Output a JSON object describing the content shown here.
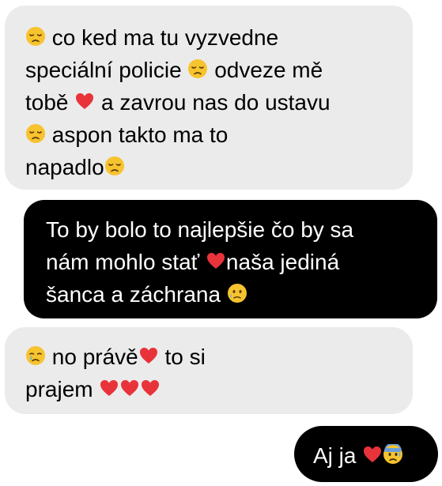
{
  "colors": {
    "received_bg": "#ebebeb",
    "received_text": "#000000",
    "sent_bg": "#000000",
    "sent_text": "#ffffff",
    "heart": "#e8333b",
    "emoji_yellow": "#f7c32e"
  },
  "messages": [
    {
      "direction": "received",
      "lines": [
        [
          {
            "icon": "disappointed-face"
          },
          {
            "text": " co ked ma tu vyzvedne"
          }
        ],
        [
          {
            "text": "speciální policie "
          },
          {
            "icon": "disappointed-face"
          },
          {
            "text": " odveze mě"
          }
        ],
        [
          {
            "text": "tobě "
          },
          {
            "icon": "red-heart"
          },
          {
            "text": " a zavrou nas do ustavu"
          }
        ],
        [
          {
            "icon": "disappointed-face"
          },
          {
            "text": " aspon takto ma to"
          }
        ],
        [
          {
            "text": "napadlo"
          },
          {
            "icon": "disappointed-face"
          }
        ]
      ]
    },
    {
      "direction": "sent",
      "lines": [
        [
          {
            "text": "To by bolo to najlepšie čo by sa"
          }
        ],
        [
          {
            "text": "nám mohlo stať "
          },
          {
            "icon": "red-heart"
          },
          {
            "text": "naša jediná"
          }
        ],
        [
          {
            "text": "šanca a záchrana "
          },
          {
            "icon": "sad-sweat-face"
          }
        ]
      ]
    },
    {
      "direction": "received",
      "lines": [
        [
          {
            "icon": "crying-face"
          },
          {
            "text": " no právě"
          },
          {
            "icon": "red-heart"
          },
          {
            "text": " to si"
          }
        ],
        [
          {
            "text": "prajem "
          },
          {
            "icon": "red-heart"
          },
          {
            "icon": "red-heart"
          },
          {
            "icon": "red-heart"
          }
        ]
      ]
    },
    {
      "direction": "sent",
      "lines": [
        [
          {
            "text": "Aj ja "
          },
          {
            "icon": "red-heart"
          },
          {
            "icon": "anxious-sweat-face"
          }
        ]
      ]
    }
  ]
}
